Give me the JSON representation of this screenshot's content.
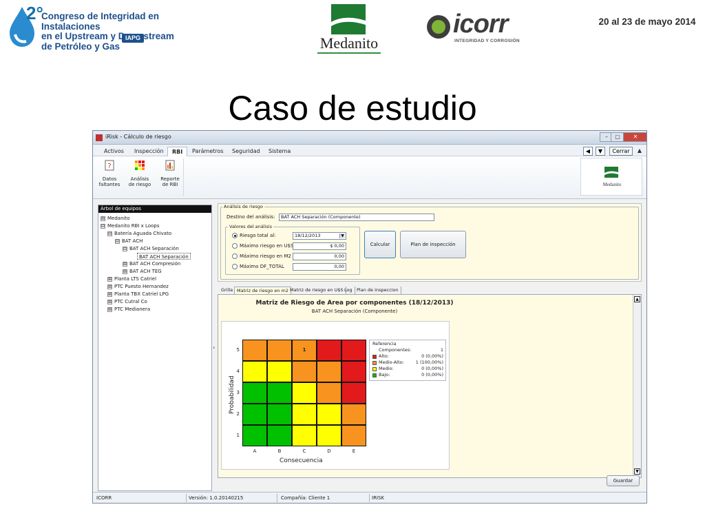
{
  "slide": {
    "congress_number": "2°",
    "congress_title_1": "Congreso de Integridad en Instalaciones",
    "congress_title_2": "en el Upstream y Downstream",
    "congress_title_3": "de Petróleo y Gas",
    "congress_org": "IAPG",
    "sponsor_1": "Medanito",
    "sponsor_2_name": "icorr",
    "sponsor_2_tagline": "INTEGRIDAD Y CORROSIÓN",
    "date": "20 al 23 de mayo 2014",
    "title": "Caso de estudio"
  },
  "window": {
    "title": "iRisk - Cálculo de riesgo",
    "controls": {
      "minimize": "–",
      "restore": "▢",
      "close": "✕"
    },
    "menu_tabs": [
      "Activos",
      "Inspección",
      "RBI",
      "Parámetros",
      "Seguridad",
      "Sistema"
    ],
    "active_tab": "RBI",
    "nav_prev": "◀",
    "nav_next": "▼",
    "close_label": "Cerrar",
    "collapse": "▲",
    "ribbon": [
      {
        "line1": "Datos",
        "line2": "faltantes",
        "icon": "question-doc-icon"
      },
      {
        "line1": "Análisis",
        "line2": "de riesgo",
        "icon": "risk-matrix-icon"
      },
      {
        "line1": "Reporte",
        "line2": "de RBI",
        "icon": "report-icon"
      }
    ],
    "ribbon_logo_label": "Medanito"
  },
  "tree": {
    "header": "Árbol de equipos",
    "items": [
      {
        "label": "Medanito",
        "exp": "⊞"
      },
      {
        "label": "Medanito RBI x Loops",
        "exp": "⊟"
      },
      {
        "label": "Batería Aguada Chivato",
        "exp": "⊟"
      },
      {
        "label": "BAT ACH",
        "exp": "⊟"
      },
      {
        "label": "BAT ACH Separación",
        "exp": "⊟"
      },
      {
        "label": "BAT ACH Separación",
        "exp": ""
      },
      {
        "label": "BAT ACH Compresión",
        "exp": "⊞"
      },
      {
        "label": "BAT ACH TEG",
        "exp": "⊞"
      },
      {
        "label": "Planta LTS Catriel",
        "exp": "⊞"
      },
      {
        "label": "PTC Puesto Hernandez",
        "exp": "⊞"
      },
      {
        "label": "Planta TBX Catriel LPG",
        "exp": "⊞"
      },
      {
        "label": "PTC Cutral Co",
        "exp": "⊞"
      },
      {
        "label": "PTC Medianera",
        "exp": "⊞"
      }
    ]
  },
  "analysis": {
    "group_label": "Análisis de riesgo",
    "destino_label": "Destino del análisis:",
    "destino_value": "BAT ACH Separación (Componente)",
    "values_label": "Valores del análisis",
    "options": [
      {
        "label": "Riesgo total al:",
        "value": "18/12/2013",
        "selected": true
      },
      {
        "label": "Máximo riesgo en U$S",
        "value": "$ 0,00",
        "selected": false
      },
      {
        "label": "Máximo riesgo en M2",
        "value": "0,00",
        "selected": false
      },
      {
        "label": "Máximo DF_TOTAL",
        "value": "0,00",
        "selected": false
      }
    ],
    "calc_button": "Calcular",
    "plan_button": "Plan de inspección"
  },
  "inner_tabs": [
    "Grilla",
    "Matriz de riesgo en m2",
    "Matriz de riesgo en U$S",
    "Log",
    "Plan de inspeccion"
  ],
  "active_inner_tab": "Matriz de riesgo en m2",
  "chart_data": {
    "type": "heatmap",
    "title": "Matriz de Riesgo de Area por componentes (18/12/2013)",
    "subtitle": "BAT ACH Separación (Componente)",
    "xlabel": "Consecuencia",
    "ylabel": "Probabilidad",
    "x_categories": [
      "A",
      "B",
      "C",
      "D",
      "E"
    ],
    "y_categories": [
      "5",
      "4",
      "3",
      "2",
      "1"
    ],
    "colors": {
      "Alto": "#e31a1c",
      "Medio-Alto": "#f7931e",
      "Medio": "#ffff00",
      "Bajo": "#00c000"
    },
    "levels": [
      [
        "Medio-Alto",
        "Medio-Alto",
        "Medio-Alto",
        "Alto",
        "Alto"
      ],
      [
        "Medio",
        "Medio",
        "Medio-Alto",
        "Medio-Alto",
        "Alto"
      ],
      [
        "Bajo",
        "Bajo",
        "Medio",
        "Medio-Alto",
        "Alto"
      ],
      [
        "Bajo",
        "Bajo",
        "Medio",
        "Medio",
        "Medio-Alto"
      ],
      [
        "Bajo",
        "Bajo",
        "Medio",
        "Medio",
        "Medio-Alto"
      ]
    ],
    "counts": [
      [
        "",
        "",
        "1",
        "",
        ""
      ],
      [
        "",
        "",
        "",
        "",
        ""
      ],
      [
        "",
        "",
        "",
        "",
        ""
      ],
      [
        "",
        "",
        "",
        "",
        ""
      ],
      [
        "",
        "",
        "",
        "",
        ""
      ]
    ],
    "legend": {
      "title": "Referencia",
      "rows": [
        {
          "name": "Componentes:",
          "value": "1",
          "swatch": ""
        },
        {
          "name": "Alto:",
          "value": "0 (0,00%)",
          "swatch": "#e31a1c"
        },
        {
          "name": "Medio-Alto:",
          "value": "1 (100,00%)",
          "swatch": "#f7931e"
        },
        {
          "name": "Medio:",
          "value": "0 (0,00%)",
          "swatch": "#ffff00"
        },
        {
          "name": "Bajo:",
          "value": "0 (0,00%)",
          "swatch": "#00c000"
        }
      ]
    }
  },
  "save_button": "Guardar",
  "status": {
    "user": "ICORR",
    "version": "Versión: 1.0.20140215",
    "company": "Compañía: Cliente 1",
    "app": "IRISK"
  }
}
